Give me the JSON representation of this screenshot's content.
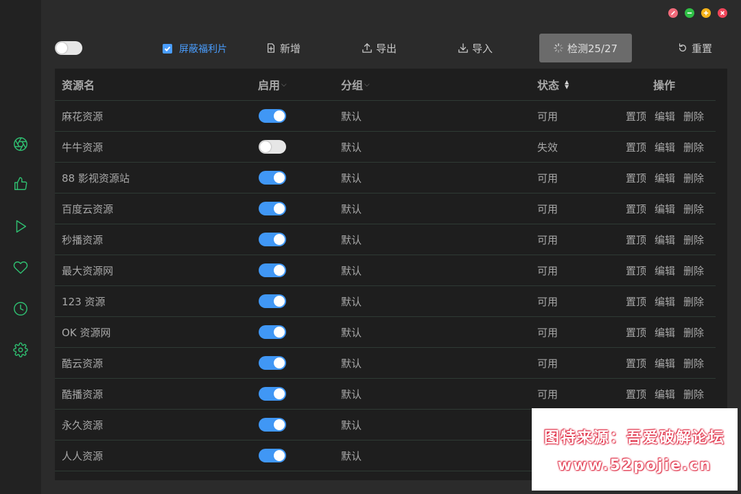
{
  "window": {
    "controls": [
      "pin",
      "minimize",
      "maximize",
      "close"
    ],
    "colors": {
      "pin": "#f06a7a",
      "minimize": "#2fbf45",
      "maximize": "#f5b31a",
      "close": "#f0455a"
    }
  },
  "sidebar": {
    "items": [
      {
        "icon": "aperture-icon"
      },
      {
        "icon": "thumbs-up-icon"
      },
      {
        "icon": "play-icon"
      },
      {
        "icon": "heart-icon"
      },
      {
        "icon": "clock-icon"
      },
      {
        "icon": "gear-icon"
      }
    ]
  },
  "toolbar": {
    "filter_label": "屏蔽福利片",
    "filter_checked": true,
    "add_label": "新增",
    "export_label": "导出",
    "import_label": "导入",
    "check_label": "检测25/27",
    "reset_label": "重置"
  },
  "table": {
    "headers": {
      "name": "资源名",
      "enabled": "启用",
      "group": "分组",
      "status": "状态",
      "actions": "操作"
    },
    "action_labels": {
      "top": "置顶",
      "edit": "编辑",
      "delete": "删除"
    },
    "rows": [
      {
        "name": "麻花资源",
        "enabled": true,
        "group": "默认",
        "status": "可用"
      },
      {
        "name": "牛牛资源",
        "enabled": false,
        "group": "默认",
        "status": "失效"
      },
      {
        "name": "88 影视资源站",
        "enabled": true,
        "group": "默认",
        "status": "可用"
      },
      {
        "name": "百度云资源",
        "enabled": true,
        "group": "默认",
        "status": "可用"
      },
      {
        "name": "秒播资源",
        "enabled": true,
        "group": "默认",
        "status": "可用"
      },
      {
        "name": "最大资源网",
        "enabled": true,
        "group": "默认",
        "status": "可用"
      },
      {
        "name": "123 资源",
        "enabled": true,
        "group": "默认",
        "status": "可用"
      },
      {
        "name": "OK 资源网",
        "enabled": true,
        "group": "默认",
        "status": "可用"
      },
      {
        "name": "酷云资源",
        "enabled": true,
        "group": "默认",
        "status": "可用"
      },
      {
        "name": "酷播资源",
        "enabled": true,
        "group": "默认",
        "status": "可用"
      },
      {
        "name": "永久资源",
        "enabled": true,
        "group": "默认",
        "status": ""
      },
      {
        "name": "人人资源",
        "enabled": true,
        "group": "默认",
        "status": ""
      }
    ]
  },
  "watermark": {
    "line1": "图特来源：吾爱破解论坛",
    "line2": "www.52pojie.cn"
  },
  "colors": {
    "accent": "#4097f5",
    "sidebar_icon": "#2fbf71",
    "background": "#2b2b2b",
    "table_bg": "#1e1e1e"
  }
}
